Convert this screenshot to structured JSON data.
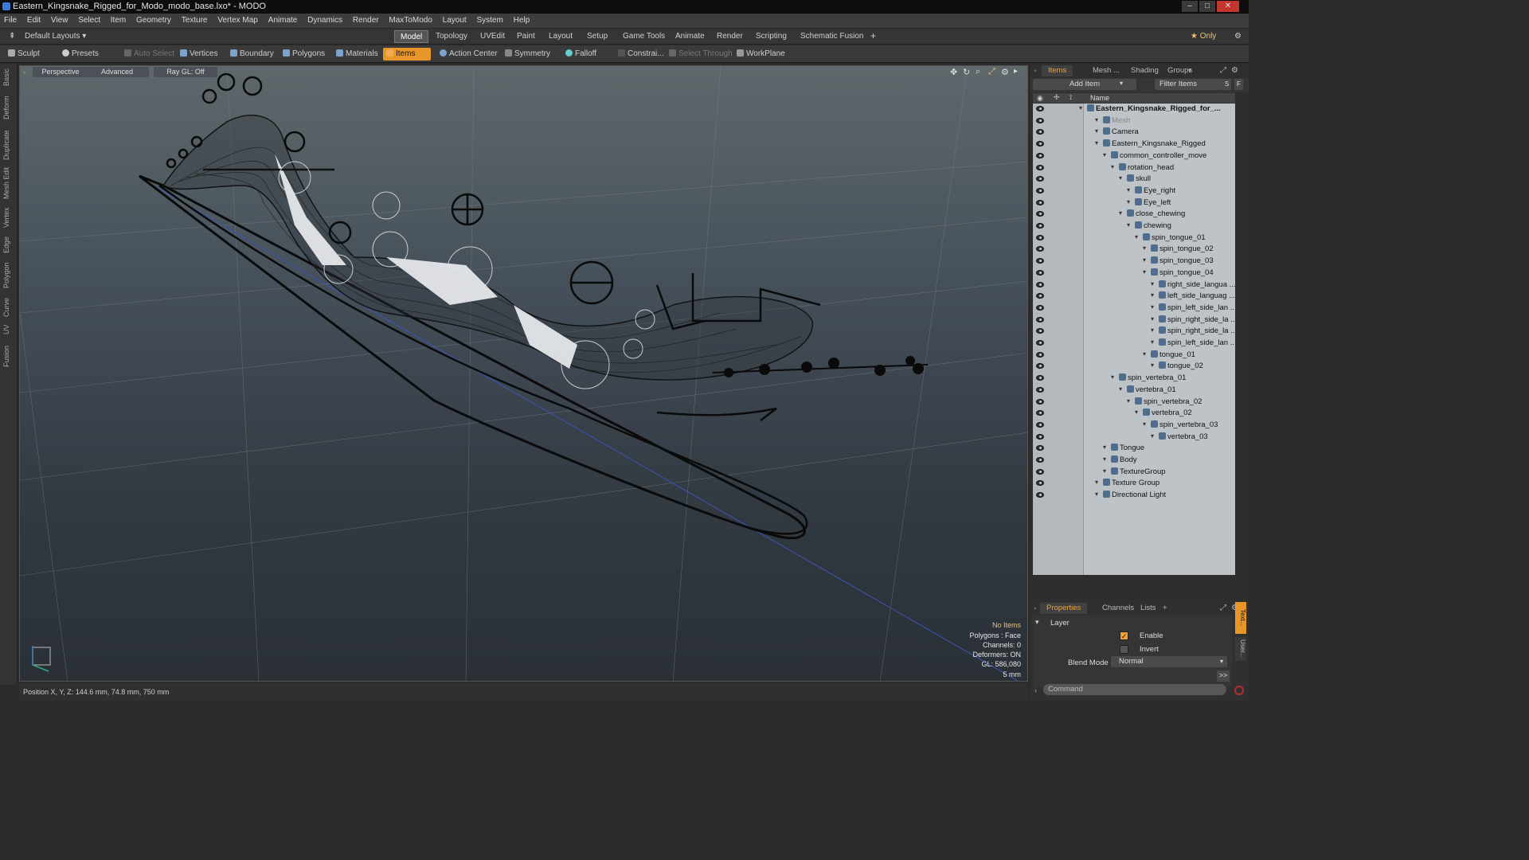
{
  "window": {
    "title": "Eastern_Kingsnake_Rigged_for_Modo_modo_base.lxo* - MODO",
    "minimize": "–",
    "maximize": "□",
    "close": "✕"
  },
  "menu": [
    "File",
    "Edit",
    "View",
    "Select",
    "Item",
    "Geometry",
    "Texture",
    "Vertex Map",
    "Animate",
    "Dynamics",
    "Render",
    "MaxToModo",
    "Layout",
    "System",
    "Help"
  ],
  "layout": {
    "preset": "Default Layouts ▾",
    "tabs": [
      "Model",
      "Topology",
      "UVEdit",
      "Paint",
      "Layout",
      "Setup",
      "Game Tools",
      "Animate",
      "Render",
      "Scripting",
      "Schematic Fusion"
    ],
    "add": "+",
    "only": "★  Only",
    "settings": "⚙"
  },
  "toolbar": {
    "sculpt": "Sculpt",
    "presets": "Presets",
    "auto_select": "Auto Select",
    "vertices": "Vertices",
    "boundary": "Boundary",
    "polygons": "Polygons",
    "materials": "Materials",
    "items": "Items",
    "action_center": "Action Center",
    "symmetry": "Symmetry",
    "falloff": "Falloff",
    "constraints": "Constrai...",
    "select_through": "Select Through",
    "workplane": "WorkPlane"
  },
  "left_tabs": [
    "Basic",
    "Deform",
    "Duplicate",
    "Mesh Edit",
    "Vertex",
    "Edge",
    "Polygon",
    "Curve",
    "UV",
    "Fusion"
  ],
  "viewport": {
    "view": "Perspective",
    "shading": "Advanced",
    "raygl": "Ray GL: Off",
    "info": [
      "No Items",
      "Polygons : Face",
      "Channels: 0",
      "Deformers: ON",
      "GL: 586,080",
      "5 mm"
    ]
  },
  "status": {
    "position": "Position X, Y, Z:   144.6 mm, 74.8 mm, 750 mm"
  },
  "items_panel": {
    "tabs": [
      "Items",
      "Mesh ...",
      "Shading",
      "Groups"
    ],
    "add_item": "Add Item",
    "filter": "Filter Items",
    "s": "S",
    "f": "F",
    "name_header": "Name",
    "rows": [
      {
        "label": "Eastern_Kingsnake_Rigged_for_...",
        "depth": 0,
        "bold": true
      },
      {
        "label": "Mesh",
        "depth": 2,
        "faded": true
      },
      {
        "label": "Camera",
        "depth": 2
      },
      {
        "label": "Eastern_Kingsnake_Rigged",
        "depth": 2
      },
      {
        "label": "common_controller_move",
        "depth": 3
      },
      {
        "label": "rotation_head",
        "depth": 4
      },
      {
        "label": "skull",
        "depth": 5
      },
      {
        "label": "Eye_right",
        "depth": 6
      },
      {
        "label": "Eye_left",
        "depth": 6
      },
      {
        "label": "close_chewing",
        "depth": 5
      },
      {
        "label": "chewing",
        "depth": 6
      },
      {
        "label": "spin_tongue_01",
        "depth": 7
      },
      {
        "label": "spin_tongue_02",
        "depth": 8
      },
      {
        "label": "spin_tongue_03",
        "depth": 8
      },
      {
        "label": "spin_tongue_04",
        "depth": 8
      },
      {
        "label": "right_side_langua ...",
        "depth": 9
      },
      {
        "label": "left_side_languag ...",
        "depth": 9
      },
      {
        "label": "spin_left_side_lan ...",
        "depth": 9
      },
      {
        "label": "spin_right_side_la ...",
        "depth": 9
      },
      {
        "label": "spin_right_side_la ...",
        "depth": 9
      },
      {
        "label": "spin_left_side_lan ...",
        "depth": 9
      },
      {
        "label": "tongue_01",
        "depth": 8
      },
      {
        "label": "tongue_02",
        "depth": 9
      },
      {
        "label": "spin_vertebra_01",
        "depth": 4
      },
      {
        "label": "vertebra_01",
        "depth": 5
      },
      {
        "label": "spin_vertebra_02",
        "depth": 6
      },
      {
        "label": "vertebra_02",
        "depth": 7
      },
      {
        "label": "spin_vertebra_03",
        "depth": 8
      },
      {
        "label": "vertebra_03",
        "depth": 9
      },
      {
        "label": "Tongue",
        "depth": 3
      },
      {
        "label": "Body",
        "depth": 3
      },
      {
        "label": "TextureGroup",
        "depth": 3
      },
      {
        "label": "Texture Group",
        "depth": 2
      },
      {
        "label": "Directional Light",
        "depth": 2
      }
    ]
  },
  "properties_panel": {
    "tabs": [
      "Properties",
      "Channels",
      "Lists"
    ],
    "add": "+",
    "section": "Layer",
    "enable": "Enable",
    "invert": "Invert",
    "blend_label": "Blend Mode",
    "blend_value": "Normal",
    "more": ">>",
    "command_placeholder": "Command"
  },
  "colors": {
    "accent": "#e8962a",
    "tree_bg": "#bdc3c7",
    "viewport_top": "#5e686b",
    "viewport_bottom": "#2a3036"
  }
}
